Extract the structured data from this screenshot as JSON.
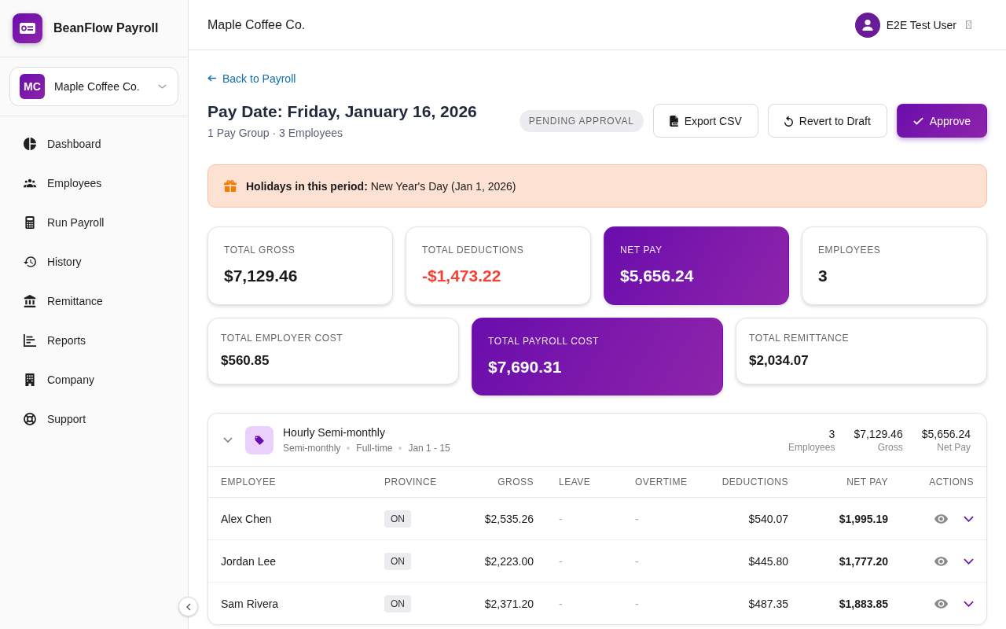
{
  "app": {
    "name": "BeanFlow Payroll"
  },
  "company_selector": {
    "initials": "MC",
    "name": "Maple Coffee Co."
  },
  "sidebar": {
    "items": [
      {
        "label": "Dashboard",
        "selected": false
      },
      {
        "label": "Employees",
        "selected": false
      },
      {
        "label": "Run Payroll",
        "selected": false
      },
      {
        "label": "History",
        "selected": false
      },
      {
        "label": "Remittance",
        "selected": false
      },
      {
        "label": "Reports",
        "selected": false
      },
      {
        "label": "Company",
        "selected": false
      },
      {
        "label": "Support",
        "selected": false
      }
    ]
  },
  "topbar": {
    "title": "Maple Coffee Co.",
    "user": {
      "name": "E2E Test User"
    }
  },
  "back_link": "Back to Payroll",
  "header": {
    "title": "Pay Date: Friday, January 16, 2026",
    "subtitle": "1 Pay Group · 3 Employees",
    "status": "PENDING APPROVAL"
  },
  "actions": [
    {
      "label": "Export CSV",
      "kind": "outlined"
    },
    {
      "label": "Revert to Draft",
      "kind": "outlined"
    },
    {
      "label": "Approve",
      "kind": "primary"
    }
  ],
  "holiday_banner": {
    "text": "**Holidays in this period:** New Year's Day (Jan 1, 2026)"
  },
  "summary_cards": [
    {
      "label": "TOTAL GROSS",
      "value": "$7,129.46",
      "kind": "plain"
    },
    {
      "label": "TOTAL DEDUCTIONS",
      "value": "-$1,473.22",
      "kind": "negative"
    },
    {
      "label": "NET PAY",
      "value": "$5,656.24",
      "kind": "highlight"
    },
    {
      "label": "EMPLOYEES",
      "value": "3",
      "kind": "plain"
    }
  ],
  "cost_cards": [
    {
      "label": "TOTAL EMPLOYER COST",
      "value": "$560.85",
      "kind": "plain"
    },
    {
      "label": "TOTAL PAYROLL COST",
      "value": "$7,690.31",
      "kind": "highlight"
    },
    {
      "label": "TOTAL REMITTANCE",
      "value": "$2,034.07",
      "kind": "plain"
    }
  ],
  "pay_groups": [
    {
      "name": "Hourly Semi-monthly",
      "expanded": true,
      "meta": [
        "Semi-monthly",
        "Full-time",
        "Jan 1 - 15"
      ],
      "stats": [
        {
          "value": "3",
          "label": "Employees"
        },
        {
          "value": "$7,129.46",
          "label": "Gross"
        },
        {
          "value": "$5,656.24",
          "label": "Net Pay"
        }
      ],
      "table": {
        "columns": [
          "EMPLOYEE",
          "PROVINCE",
          "GROSS",
          "LEAVE",
          "OVERTIME",
          "DEDUCTIONS",
          "NET PAY",
          "ACTIONS"
        ],
        "rows": [
          {
            "employee": "Alex Chen",
            "province": "ON",
            "gross": "$2,535.26",
            "leave": "-",
            "overtime": "-",
            "deductions": "$540.07",
            "net_pay": "$1,995.19"
          },
          {
            "employee": "Jordan Lee",
            "province": "ON",
            "gross": "$2,223.00",
            "leave": "-",
            "overtime": "-",
            "deductions": "$445.80",
            "net_pay": "$1,777.20"
          },
          {
            "employee": "Sam Rivera",
            "province": "ON",
            "gross": "$2,371.20",
            "leave": "-",
            "overtime": "-",
            "deductions": "$487.35",
            "net_pay": "$1,883.85"
          }
        ]
      }
    }
  ]
}
